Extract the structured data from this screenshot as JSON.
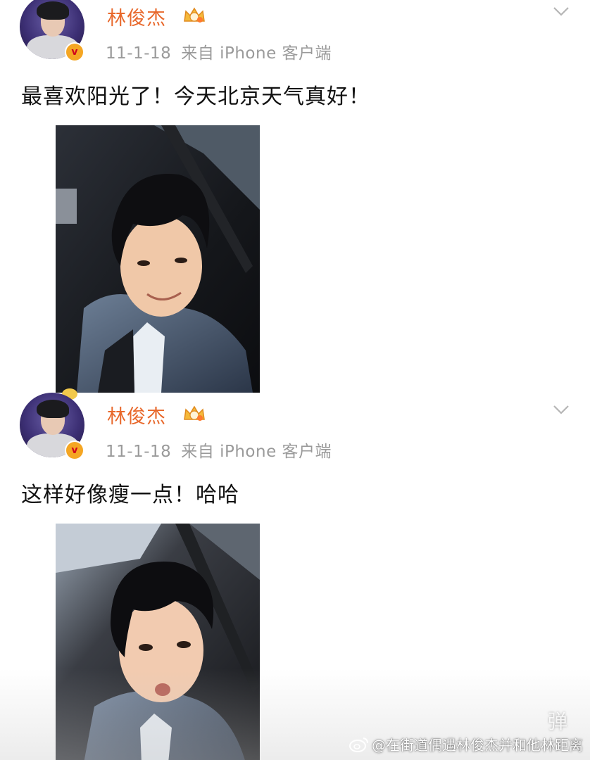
{
  "posts": [
    {
      "username": "林俊杰",
      "verified_mark": "v",
      "timestamp": "11-1-18",
      "source": "来自 iPhone 客户端",
      "text": "最喜欢阳光了！今天北京天气真好！",
      "photo_icon": "selfie-photo"
    },
    {
      "username": "林俊杰",
      "verified_mark": "v",
      "timestamp": "11-1-18",
      "source": "来自 iPhone 客户端",
      "text": "这样好像瘦一点！哈哈",
      "photo_icon": "selfie-photo"
    }
  ],
  "watermark": {
    "text": "@在街道偶遇林俊杰并和他林距离",
    "icon": "weibo-icon"
  },
  "danmaku_button": "弹",
  "colors": {
    "username": "#e8682b",
    "meta": "#9a9a9a",
    "text": "#111111",
    "badge": "#f5a623"
  }
}
